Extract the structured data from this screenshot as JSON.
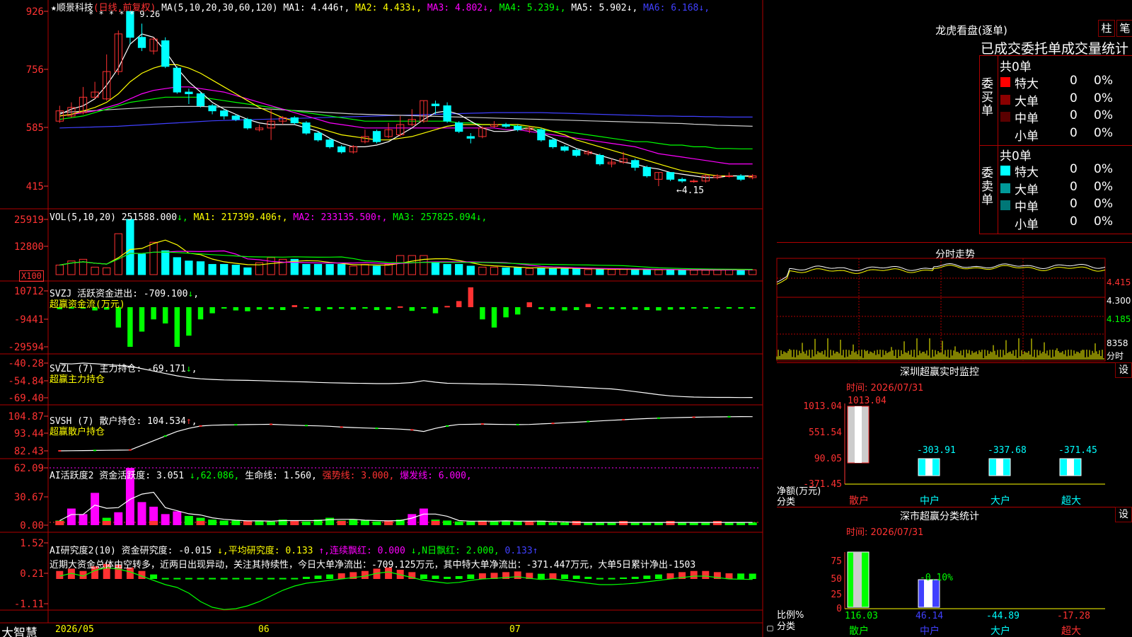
{
  "colors": {
    "red": "#ff3232",
    "cyan": "#00ffff",
    "green": "#00ff00",
    "white": "#ffffff",
    "yellow": "#ffff00",
    "magenta": "#ff00ff",
    "blue": "#4040ff",
    "grid": "#b00000"
  },
  "main": {
    "title_star": "★",
    "stock_name": "顺景科技",
    "mode": "(日线,前复权)",
    "ma_label": "MA(5,10,20,30,60,120)",
    "ma_items": [
      {
        "label": "MA1: 4.446",
        "arrow": "↑",
        "color": "#ffffff"
      },
      {
        "label": "MA2: 4.433",
        "arrow": "↓",
        "color": "#ffff00"
      },
      {
        "label": "MA3: 4.802",
        "arrow": "↓",
        "color": "#ff00ff"
      },
      {
        "label": "MA4: 5.239",
        "arrow": "↓",
        "color": "#00ff00"
      },
      {
        "label": "MA5: 5.902",
        "arrow": "↓",
        "color": "#ffffff"
      },
      {
        "label": "MA6: 6.168",
        "arrow": "↓",
        "color": "#4040ff"
      }
    ],
    "ylabels": [
      "926",
      "756",
      "585",
      "415"
    ],
    "hi_label": "9.26",
    "lo_label": "←4.15",
    "stars": "* * * * *"
  },
  "vol": {
    "label": "VOL(5,10,20)",
    "value": "251588.000",
    "items": [
      {
        "label": "MA1: 217399.406",
        "arrow": "↑",
        "color": "#ffff00"
      },
      {
        "label": "MA2: 233135.500",
        "arrow": "↑",
        "color": "#ff00ff"
      },
      {
        "label": "MA3: 257825.094",
        "arrow": "↓",
        "color": "#00ff00"
      }
    ],
    "ylabels": [
      "25919",
      "12800"
    ],
    "unit": "X100"
  },
  "svzj": {
    "label": "SVZJ  活跃资金进出: -709.100",
    "arrow": "↓",
    "sub": "超赢资金流(万元)",
    "ylabels": [
      "10712",
      "-9441",
      "-29594"
    ]
  },
  "svzl": {
    "label": "SVZL (7) 主力持仓: -69.171",
    "arrow": "↓",
    "sub": "超赢主力持仓",
    "ylabels": [
      "-40.28",
      "-54.84",
      "-69.40"
    ]
  },
  "svsh": {
    "label": "SVSH (7) 散户持仓: 104.534",
    "arrow": "↑",
    "sub": "超赢散户持仓",
    "ylabels": [
      "104.87",
      "93.44",
      "82.43"
    ]
  },
  "ai1": {
    "label": "AI活跃度2 资金活跃度: 3.051",
    "items": [
      {
        "label": "↓,62.086,",
        "color": "#00ff00"
      },
      {
        "label": "生命线: 1.560,",
        "color": "#ffffff"
      },
      {
        "label": "强势线: 3.000,",
        "color": "#ff3232"
      },
      {
        "label": "爆发线: 6.000,",
        "color": "#ff00ff"
      }
    ],
    "ylabels": [
      "62.09",
      "30.67",
      "0.00"
    ]
  },
  "ai2": {
    "label": "AI研究度2(10) 资金研究度: -0.015",
    "items": [
      {
        "label": "↓,平均研究度: 0.133",
        "color": "#ffff00"
      },
      {
        "label": "↑,连续飘红: 0.000",
        "color": "#ff00ff"
      },
      {
        "label": "↓,N日飘红: 2.000,",
        "color": "#00ff00"
      },
      {
        "label": "0.133↑",
        "color": "#4040ff"
      }
    ],
    "text": "近期大资金总体由空转多，近两日出现异动，关注其持续性，今日大单净流出：-709.125万元，其中特大单净流出：-371.447万元，大单5日累计净出-1503",
    "ylabels": [
      "1.52",
      "0.21",
      "-1.11"
    ]
  },
  "xaxis": {
    "labels": [
      "2026/05",
      "06",
      "07"
    ],
    "brand": "大智慧"
  },
  "dragon": {
    "title": "龙虎看盘(逐单)",
    "btn1": "柱",
    "btn2": "笔",
    "subtitle": "已成交委托单成交量统计",
    "buy_label": "委买单",
    "sell_label": "委卖单",
    "buy_total": "共0单",
    "sell_total": "共0单",
    "buy_rows": [
      {
        "name": "特大",
        "count": "0",
        "pct": "0%",
        "color": "#ff0000"
      },
      {
        "name": "大单",
        "count": "0",
        "pct": "0%",
        "color": "#8b0000"
      },
      {
        "name": "中单",
        "count": "0",
        "pct": "0%",
        "color": "#5a0000"
      },
      {
        "name": "小单",
        "count": "0",
        "pct": "0%",
        "color": ""
      }
    ],
    "sell_rows": [
      {
        "name": "特大",
        "count": "0",
        "pct": "0%",
        "color": "#00ffff"
      },
      {
        "name": "大单",
        "count": "0",
        "pct": "0%",
        "color": "#009999"
      },
      {
        "name": "中单",
        "count": "0",
        "pct": "0%",
        "color": "#007777"
      },
      {
        "name": "小单",
        "count": "0",
        "pct": "0%",
        "color": ""
      }
    ]
  },
  "intraday": {
    "title": "分时走势",
    "ylabels": [
      "4.415",
      "4.300",
      "4.185"
    ],
    "vol_label": "8358",
    "vol_unit": "分时"
  },
  "monitor": {
    "title": "深圳超赢实时监控",
    "btn": "设",
    "time": "时间: 2026/07/31",
    "ylabels": [
      "1013.04",
      "551.54",
      "90.05",
      "-371.45"
    ],
    "unit1": "净额(万元)",
    "unit2": "分类",
    "cats": [
      "散户",
      "中户",
      "大户",
      "超大"
    ],
    "values": [
      1013.04,
      -303.91,
      -337.68,
      -371.45
    ],
    "vlabels": [
      "1013.04",
      "-303.91",
      "-337.68",
      "-371.45"
    ]
  },
  "classify": {
    "title": "深市超赢分类统计",
    "btn": "设",
    "time": "时间: 2026/07/31",
    "ylabels": [
      "75",
      "50",
      "25",
      "0"
    ],
    "unit1": "比例%",
    "unit2": "分类",
    "cats": [
      "散户",
      "中户",
      "大户",
      "超大"
    ],
    "pcts": [
      100,
      50,
      0,
      0
    ],
    "vlabels": [
      "116.03",
      "46.14",
      "-44.89",
      "-17.28"
    ],
    "mid_label": "-0.10%"
  },
  "chart_data": {
    "type": "candlestick",
    "candles": [
      [
        6.05,
        6.35,
        6.5,
        6.0
      ],
      [
        6.2,
        6.45,
        6.6,
        6.15
      ],
      [
        6.3,
        6.75,
        7.05,
        6.25
      ],
      [
        6.75,
        6.9,
        7.2,
        6.7
      ],
      [
        6.7,
        7.5,
        8.0,
        6.65
      ],
      [
        7.5,
        8.6,
        8.7,
        7.4
      ],
      [
        9.26,
        8.5,
        9.26,
        8.3
      ],
      [
        8.5,
        8.2,
        8.9,
        8.1
      ],
      [
        8.1,
        8.45,
        8.5,
        8.0
      ],
      [
        8.4,
        7.65,
        8.5,
        7.6
      ],
      [
        7.6,
        6.9,
        7.65,
        6.85
      ],
      [
        6.9,
        6.85,
        7.0,
        6.55
      ],
      [
        6.85,
        6.5,
        6.9,
        6.45
      ],
      [
        6.5,
        6.35,
        6.55,
        6.25
      ],
      [
        6.35,
        6.2,
        6.4,
        6.1
      ],
      [
        6.2,
        6.1,
        6.25,
        6.05
      ],
      [
        6.1,
        5.85,
        6.15,
        5.8
      ],
      [
        5.8,
        5.85,
        5.95,
        5.75
      ],
      [
        5.85,
        6.05,
        6.4,
        5.5
      ],
      [
        6.05,
        6.15,
        6.2,
        5.95
      ],
      [
        6.15,
        6.0,
        6.2,
        5.95
      ],
      [
        6.0,
        5.7,
        6.05,
        5.65
      ],
      [
        5.7,
        5.5,
        5.75,
        5.45
      ],
      [
        5.5,
        5.3,
        5.55,
        5.25
      ],
      [
        5.3,
        5.15,
        5.35,
        5.1
      ],
      [
        5.15,
        5.3,
        5.35,
        5.1
      ],
      [
        5.45,
        5.6,
        5.8,
        5.4
      ],
      [
        5.75,
        5.45,
        5.8,
        5.4
      ],
      [
        5.6,
        5.8,
        6.0,
        5.55
      ],
      [
        5.65,
        5.95,
        6.2,
        5.6
      ],
      [
        5.95,
        6.1,
        6.4,
        5.9
      ],
      [
        6.05,
        6.65,
        6.65,
        6.0
      ],
      [
        6.55,
        6.5,
        6.65,
        6.25
      ],
      [
        6.5,
        6.05,
        6.6,
        6.0
      ],
      [
        6.0,
        5.75,
        6.05,
        5.7
      ],
      [
        5.6,
        5.55,
        5.7,
        5.4
      ],
      [
        5.6,
        5.85,
        5.9,
        5.55
      ],
      [
        5.9,
        5.95,
        6.05,
        5.85
      ],
      [
        5.95,
        5.9,
        6.0,
        5.85
      ],
      [
        5.9,
        5.8,
        5.95,
        5.75
      ],
      [
        5.8,
        5.85,
        5.9,
        5.7
      ],
      [
        5.8,
        5.5,
        5.85,
        5.45
      ],
      [
        5.5,
        5.3,
        5.55,
        5.25
      ],
      [
        5.3,
        5.2,
        5.35,
        5.15
      ],
      [
        5.2,
        5.05,
        5.25,
        5.0
      ],
      [
        5.1,
        5.15,
        5.2,
        5.05
      ],
      [
        5.05,
        4.8,
        5.1,
        4.75
      ],
      [
        4.8,
        4.85,
        4.95,
        4.7
      ],
      [
        4.85,
        4.95,
        5.15,
        4.8
      ],
      [
        4.9,
        4.7,
        4.95,
        4.6
      ],
      [
        4.7,
        4.45,
        4.75,
        4.4
      ],
      [
        4.35,
        4.55,
        4.55,
        4.15
      ],
      [
        4.55,
        4.35,
        4.55,
        4.3
      ],
      [
        4.35,
        4.3,
        4.4,
        4.25
      ],
      [
        4.3,
        4.3,
        4.35,
        4.25
      ],
      [
        4.3,
        4.45,
        4.5,
        4.25
      ],
      [
        4.4,
        4.45,
        4.5,
        4.35
      ],
      [
        4.45,
        4.45,
        4.55,
        4.4
      ],
      [
        4.45,
        4.35,
        4.5,
        4.3
      ],
      [
        4.4,
        4.45,
        4.5,
        4.35
      ]
    ],
    "volume": [
      2.8,
      4.0,
      4.5,
      2.2,
      2.0,
      12.0,
      16.2,
      6.0,
      9.5,
      7.0,
      5.0,
      4.0,
      3.8,
      3.0,
      3.0,
      2.8,
      2.0,
      3.5,
      5.0,
      4.5,
      4.5,
      3.0,
      3.0,
      3.0,
      3.0,
      2.5,
      3.0,
      2.5,
      3.0,
      5.6,
      5.6,
      5.6,
      3.5,
      3.0,
      3.0,
      2.5,
      2.2,
      2.2,
      2.0,
      2.0,
      1.8,
      2.0,
      1.8,
      1.8,
      1.7,
      1.5,
      1.5,
      1.5,
      1.6,
      1.6,
      1.4,
      1.4,
      1.4,
      1.4,
      1.3,
      1.3,
      1.4,
      1.5,
      1.4,
      1.4
    ],
    "flow": [
      -500,
      -300,
      -200,
      -800,
      -600,
      -5000,
      -15000,
      -6000,
      -3000,
      -4000,
      -12000,
      -7000,
      -3000,
      -1500,
      -300,
      -800,
      -1000,
      -600,
      -500,
      -700,
      500,
      -300,
      -900,
      -500,
      -400,
      -600,
      -300,
      -700,
      -600,
      200,
      -900,
      -200,
      -1500,
      300,
      1500,
      6000,
      -3000,
      -5000,
      -2500,
      -1800,
      1200,
      -500,
      -900,
      -800,
      -700,
      800,
      -400,
      -500,
      -500,
      -600,
      -700,
      -800,
      -600,
      -500,
      -300,
      -200,
      -300,
      -200,
      -300,
      -200
    ],
    "svzl": [
      -40.5,
      -41,
      -40.28,
      -40.8,
      -41.5,
      -42.2,
      -43,
      -45,
      -47,
      -49,
      -51,
      -52.5,
      -53.5,
      -54,
      -54.4,
      -54.6,
      -54.8,
      -55,
      -55.3,
      -55.6,
      -55.9,
      -56.1,
      -56.5,
      -56.8,
      -57,
      -57.2,
      -57.3,
      -57.5,
      -57.5,
      -57.2,
      -56.6,
      -55,
      -56.3,
      -57.2,
      -57.4,
      -57.6,
      -57.8,
      -57.8,
      -58,
      -58.3,
      -58.6,
      -58.9,
      -59.4,
      -60,
      -60.5,
      -61,
      -61.5,
      -62,
      -63,
      -64.2,
      -65.5,
      -66.8,
      -67.8,
      -68.4,
      -68.8,
      -69,
      -69.1,
      -69.1,
      -69.2,
      -69.17
    ],
    "svsh": [
      82.43,
      82.5,
      82.6,
      82.7,
      82.8,
      82.9,
      83,
      86,
      89,
      92,
      95,
      97,
      98.5,
      99,
      99.2,
      99.3,
      99.4,
      99.5,
      99.6,
      99.3,
      99,
      98.8,
      98.6,
      98.3,
      97.8,
      97.5,
      97.2,
      97,
      96.8,
      96.5,
      96,
      95,
      97,
      98.5,
      99.5,
      99.6,
      99.8,
      99.6,
      99.5,
      99.4,
      99.5,
      99.9,
      100.2,
      100.6,
      101,
      101.4,
      101.8,
      102.2,
      102.6,
      103,
      103.3,
      103.6,
      103.8,
      104,
      104.2,
      104.3,
      104.4,
      104.5,
      104.6,
      104.534
    ],
    "active": [
      5,
      18,
      12,
      35,
      8,
      14,
      62,
      25,
      20,
      12,
      15,
      10,
      8,
      6,
      5,
      5,
      4,
      5,
      4,
      6,
      5,
      4,
      6,
      8,
      5,
      6,
      5,
      4,
      5,
      6,
      12,
      18,
      6,
      5,
      4,
      4,
      5,
      4,
      5,
      4,
      4,
      5,
      3,
      3,
      3,
      3,
      3,
      3,
      3,
      3,
      3,
      3,
      3,
      3,
      3,
      3,
      3,
      3,
      3,
      3
    ],
    "research": [
      0.1,
      0.2,
      0.1,
      0.3,
      0.4,
      0.35,
      0.25,
      0.1,
      -0.05,
      -0.2,
      -0.3,
      -0.5,
      -0.8,
      -1.0,
      -1.08,
      -1.05,
      -0.95,
      -0.8,
      -0.6,
      -0.4,
      -0.25,
      -0.15,
      -0.1,
      -0.05,
      0.0,
      0.05,
      0.1,
      0.2,
      0.25,
      0.15,
      0.05,
      -0.05,
      -0.1,
      -0.15,
      -0.12,
      -0.05,
      0.0,
      0.02,
      0.05,
      0.08,
      0.02,
      -0.02,
      0.0,
      -0.05,
      -0.1,
      -0.15,
      -0.2,
      -0.2,
      -0.18,
      -0.15,
      -0.1,
      -0.05,
      0.0,
      0.05,
      0.1,
      0.1,
      0.05,
      0.0,
      -0.01,
      -0.015
    ],
    "ma5": [
      6.25,
      6.4,
      6.5,
      6.7,
      7.1,
      7.6,
      8.3,
      8.6,
      8.5,
      8.1,
      7.6,
      7.2,
      6.9,
      6.6,
      6.4,
      6.25,
      6.1,
      6.0,
      5.95,
      5.95,
      5.95,
      5.85,
      5.75,
      5.55,
      5.4,
      5.3,
      5.3,
      5.35,
      5.45,
      5.65,
      5.85,
      6.1,
      6.3,
      6.35,
      6.25,
      6.05,
      5.85,
      5.75,
      5.75,
      5.8,
      5.85,
      5.7,
      5.55,
      5.4,
      5.25,
      5.15,
      5.05,
      4.95,
      4.85,
      4.8,
      4.7,
      4.65,
      4.55,
      4.5,
      4.45,
      4.4,
      4.4,
      4.45,
      4.45,
      4.45
    ],
    "ma10": [
      6.2,
      6.25,
      6.35,
      6.45,
      6.6,
      6.85,
      7.2,
      7.45,
      7.6,
      7.7,
      7.7,
      7.6,
      7.45,
      7.25,
      7.05,
      6.85,
      6.65,
      6.45,
      6.3,
      6.15,
      6.05,
      5.95,
      5.85,
      5.75,
      5.65,
      5.6,
      5.55,
      5.5,
      5.5,
      5.55,
      5.6,
      5.7,
      5.8,
      5.9,
      5.95,
      5.95,
      5.95,
      5.95,
      5.95,
      5.95,
      5.9,
      5.85,
      5.75,
      5.65,
      5.5,
      5.4,
      5.3,
      5.2,
      5.1,
      5.0,
      4.9,
      4.8,
      4.7,
      4.6,
      4.55,
      4.5,
      4.45,
      4.45,
      4.45,
      4.43
    ],
    "ma20": [
      6.2,
      6.25,
      6.3,
      6.35,
      6.45,
      6.55,
      6.7,
      6.85,
      6.95,
      7.0,
      7.05,
      7.05,
      7.0,
      6.95,
      6.9,
      6.8,
      6.7,
      6.6,
      6.5,
      6.4,
      6.3,
      6.2,
      6.1,
      6.0,
      5.95,
      5.9,
      5.85,
      5.85,
      5.85,
      5.85,
      5.85,
      5.85,
      5.85,
      5.85,
      5.85,
      5.85,
      5.85,
      5.85,
      5.8,
      5.8,
      5.75,
      5.7,
      5.65,
      5.6,
      5.55,
      5.5,
      5.45,
      5.4,
      5.35,
      5.3,
      5.2,
      5.1,
      5.05,
      5.0,
      4.95,
      4.9,
      4.85,
      4.8,
      4.8,
      4.8
    ],
    "ma30": [
      6.1,
      6.15,
      6.2,
      6.3,
      6.4,
      6.5,
      6.6,
      6.65,
      6.7,
      6.75,
      6.75,
      6.75,
      6.75,
      6.7,
      6.65,
      6.6,
      6.55,
      6.5,
      6.45,
      6.4,
      6.35,
      6.3,
      6.25,
      6.2,
      6.15,
      6.1,
      6.05,
      6.05,
      6.05,
      6.05,
      6.05,
      6.05,
      6.05,
      6.05,
      6.0,
      6.0,
      5.95,
      5.95,
      5.95,
      5.9,
      5.85,
      5.8,
      5.75,
      5.75,
      5.7,
      5.65,
      5.6,
      5.55,
      5.5,
      5.45,
      5.45,
      5.4,
      5.35,
      5.35,
      5.3,
      5.3,
      5.25,
      5.25,
      5.24,
      5.24
    ],
    "ma60": [
      6.3,
      6.32,
      6.34,
      6.36,
      6.38,
      6.4,
      6.42,
      6.44,
      6.46,
      6.47,
      6.48,
      6.48,
      6.48,
      6.47,
      6.46,
      6.45,
      6.44,
      6.42,
      6.4,
      6.38,
      6.36,
      6.34,
      6.32,
      6.3,
      6.28,
      6.26,
      6.25,
      6.24,
      6.23,
      6.22,
      6.21,
      6.2,
      6.19,
      6.18,
      6.17,
      6.16,
      6.15,
      6.14,
      6.13,
      6.12,
      6.11,
      6.1,
      6.09,
      6.08,
      6.07,
      6.06,
      6.05,
      6.04,
      6.03,
      6.02,
      6.01,
      6.0,
      5.99,
      5.98,
      5.96,
      5.95,
      5.93,
      5.92,
      5.91,
      5.9
    ],
    "ma120": [
      5.85,
      5.86,
      5.87,
      5.88,
      5.89,
      5.9,
      5.92,
      5.94,
      5.96,
      5.98,
      6.0,
      6.02,
      6.04,
      6.06,
      6.07,
      6.08,
      6.09,
      6.1,
      6.11,
      6.12,
      6.13,
      6.14,
      6.15,
      6.16,
      6.17,
      6.18,
      6.19,
      6.2,
      6.21,
      6.22,
      6.23,
      6.24,
      6.25,
      6.26,
      6.27,
      6.28,
      6.29,
      6.3,
      6.3,
      6.3,
      6.3,
      6.3,
      6.29,
      6.28,
      6.27,
      6.26,
      6.25,
      6.24,
      6.23,
      6.22,
      6.21,
      6.2,
      6.2,
      6.19,
      6.19,
      6.18,
      6.18,
      6.17,
      6.17,
      6.17
    ]
  }
}
